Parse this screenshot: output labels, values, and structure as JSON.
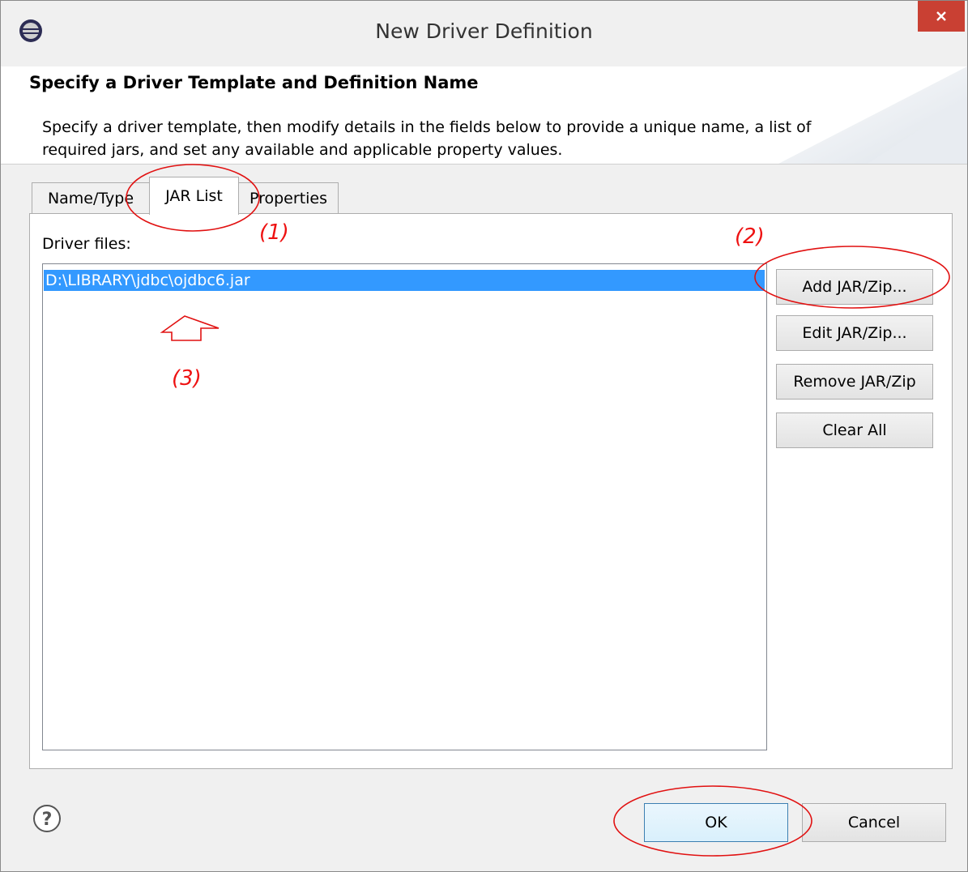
{
  "window": {
    "title": "New Driver Definition",
    "close_icon": "close-icon",
    "app_icon": "eclipse-icon"
  },
  "header": {
    "title": "Specify a Driver Template and Definition Name",
    "description": "Specify a driver template, then modify details in the fields below to provide a unique name, a list of required jars, and set any available and applicable property values."
  },
  "tabs": [
    {
      "label": "Name/Type",
      "selected": false
    },
    {
      "label": "JAR List",
      "selected": true
    },
    {
      "label": "Properties",
      "selected": false
    }
  ],
  "jar_list": {
    "label": "Driver files:",
    "items": [
      "D:\\LIBRARY\\jdbc\\ojdbc6.jar"
    ],
    "selected_index": 0
  },
  "side_buttons": {
    "add": "Add JAR/Zip...",
    "edit": "Edit JAR/Zip...",
    "remove": "Remove JAR/Zip",
    "clear": "Clear All"
  },
  "footer": {
    "help_icon": "help-icon",
    "ok_label": "OK",
    "cancel_label": "Cancel"
  },
  "annotations": {
    "marker_1": "(1)",
    "marker_2": "(2)",
    "marker_3": "(3)",
    "color": "#e11111"
  },
  "colors": {
    "selection": "#3399ff",
    "close_button": "#c94033"
  }
}
